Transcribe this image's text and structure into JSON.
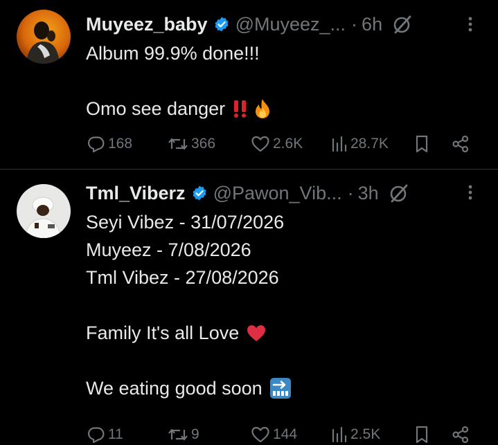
{
  "tweets": [
    {
      "display_name": "Muyeez_baby",
      "handle": "@Muyeez_...",
      "separator": "·",
      "time": "6h",
      "avatar": "avatar-person-orange-background",
      "lines": [
        "Album 99.9% done!!!",
        "",
        "Omo see danger"
      ],
      "emoji": [
        "double-exclamation-mark-emoji",
        "fire-emoji"
      ],
      "stats": {
        "replies": "168",
        "reposts": "366",
        "likes": "2.6K",
        "views": "28.7K"
      }
    },
    {
      "display_name": "Tml_Viberz",
      "handle": "@Pawon_Vib...",
      "separator": "·",
      "time": "3h",
      "avatar": "avatar-person-white-hat",
      "lines": [
        "Seyi Vibez - 31/07/2026",
        "Muyeez - 7/08/2026",
        "Tml Vibez - 27/08/2026",
        "",
        "Family It's all Love",
        "",
        "We eating good soon"
      ],
      "emoji": [
        "red-heart-emoji",
        "soon-arrow-emoji"
      ],
      "stats": {
        "replies": "11",
        "reposts": "9",
        "likes": "144",
        "views": "2.5K"
      }
    }
  ],
  "colors": {
    "background": "#000000",
    "text": "#e7e9ea",
    "secondary": "#71767b",
    "verified": "#1d9bf0",
    "divider": "#2f3336"
  }
}
